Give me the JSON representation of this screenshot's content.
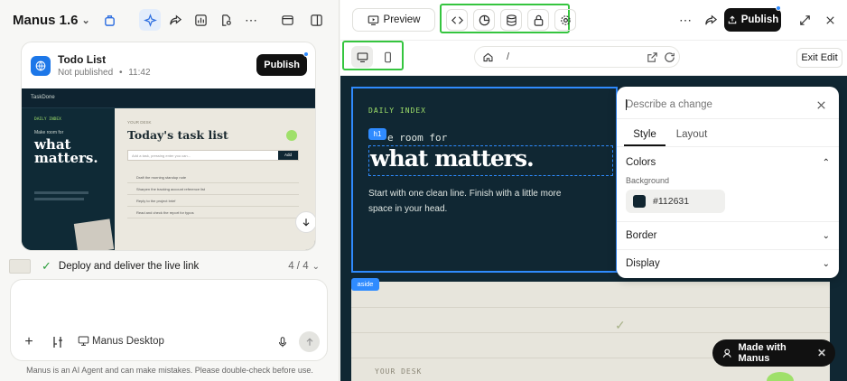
{
  "app": {
    "name": "Manus 1.6"
  },
  "project_card": {
    "title": "Todo List",
    "status": "Not published",
    "separator": "•",
    "time": "11:42",
    "publish_label": "Publish",
    "thumb": {
      "brand": "TaskDone",
      "menu": "DAILY INDEX",
      "lead": "Make room for",
      "headline_1": "what",
      "headline_2": "matters.",
      "your_desk": "YOUR DESK",
      "heading": "Today's task list",
      "input_placeholder": "Add a task, pressing enter you can...",
      "add_label": "Add",
      "items": [
        "Draft the morning standup note",
        "Sharpen the tracking account reference list",
        "Reply to the project brief",
        "Read and check the report for typos"
      ]
    }
  },
  "task": {
    "label": "Deploy and deliver the live link",
    "progress": "4 / 4"
  },
  "composer": {
    "device_label": "Manus Desktop"
  },
  "footer": {
    "disclaimer": "Manus is an AI Agent and can make mistakes. Please double-check before use."
  },
  "right_top": {
    "preview_label": "Preview",
    "publish_label": "Publish"
  },
  "address": {
    "path": "/",
    "exit_label": "Exit Edit"
  },
  "canvas": {
    "eyebrow": "DAILY INDEX",
    "badge": "h1",
    "lead": "e room for",
    "headline": "what matters.",
    "body_1": "Start with one clean line. Finish with a little more",
    "body_2": "space in your head.",
    "aside_badge": "aside",
    "your_desk": "YOUR DESK"
  },
  "style_panel": {
    "placeholder": "Describe a change",
    "tabs": [
      "Style",
      "Layout"
    ],
    "colors_label": "Colors",
    "background_label": "Background",
    "background_value": "#112631",
    "border_label": "Border",
    "display_label": "Display"
  },
  "made_with": {
    "label": "Made with Manus"
  },
  "colors": {
    "accent": "#2f8bff",
    "highlight": "#35c53f",
    "dark": "#112631"
  }
}
